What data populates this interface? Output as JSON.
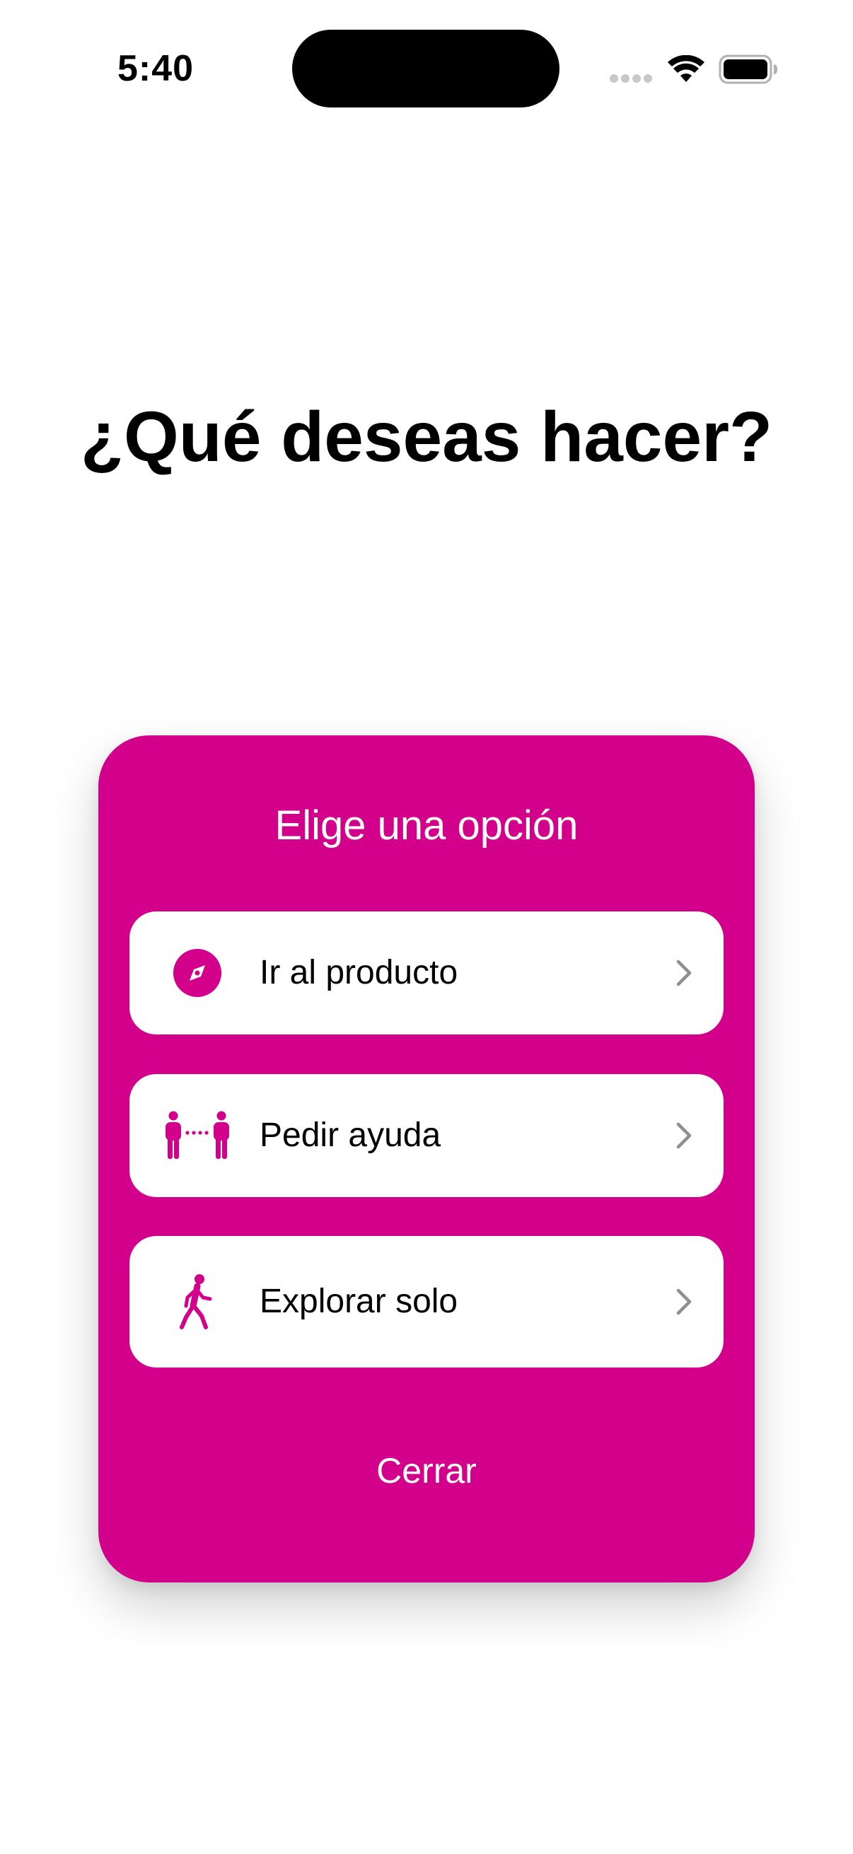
{
  "status_bar": {
    "time": "5:40",
    "icons": [
      "signal-dots-icon",
      "wifi-icon",
      "battery-icon"
    ]
  },
  "heading": {
    "title": "¿Qué deseas hacer?"
  },
  "card": {
    "title": "Elige una opción",
    "options": [
      {
        "label": "Ir al producto",
        "icon": "compass-icon"
      },
      {
        "label": "Pedir ayuda",
        "icon": "people-distance-icon"
      },
      {
        "label": "Explorar solo",
        "icon": "walking-person-icon"
      }
    ],
    "close_label": "Cerrar"
  },
  "colors": {
    "accent": "#d2008a",
    "background": "#ffffff",
    "text": "#000000",
    "chevron": "#8e8e93"
  }
}
